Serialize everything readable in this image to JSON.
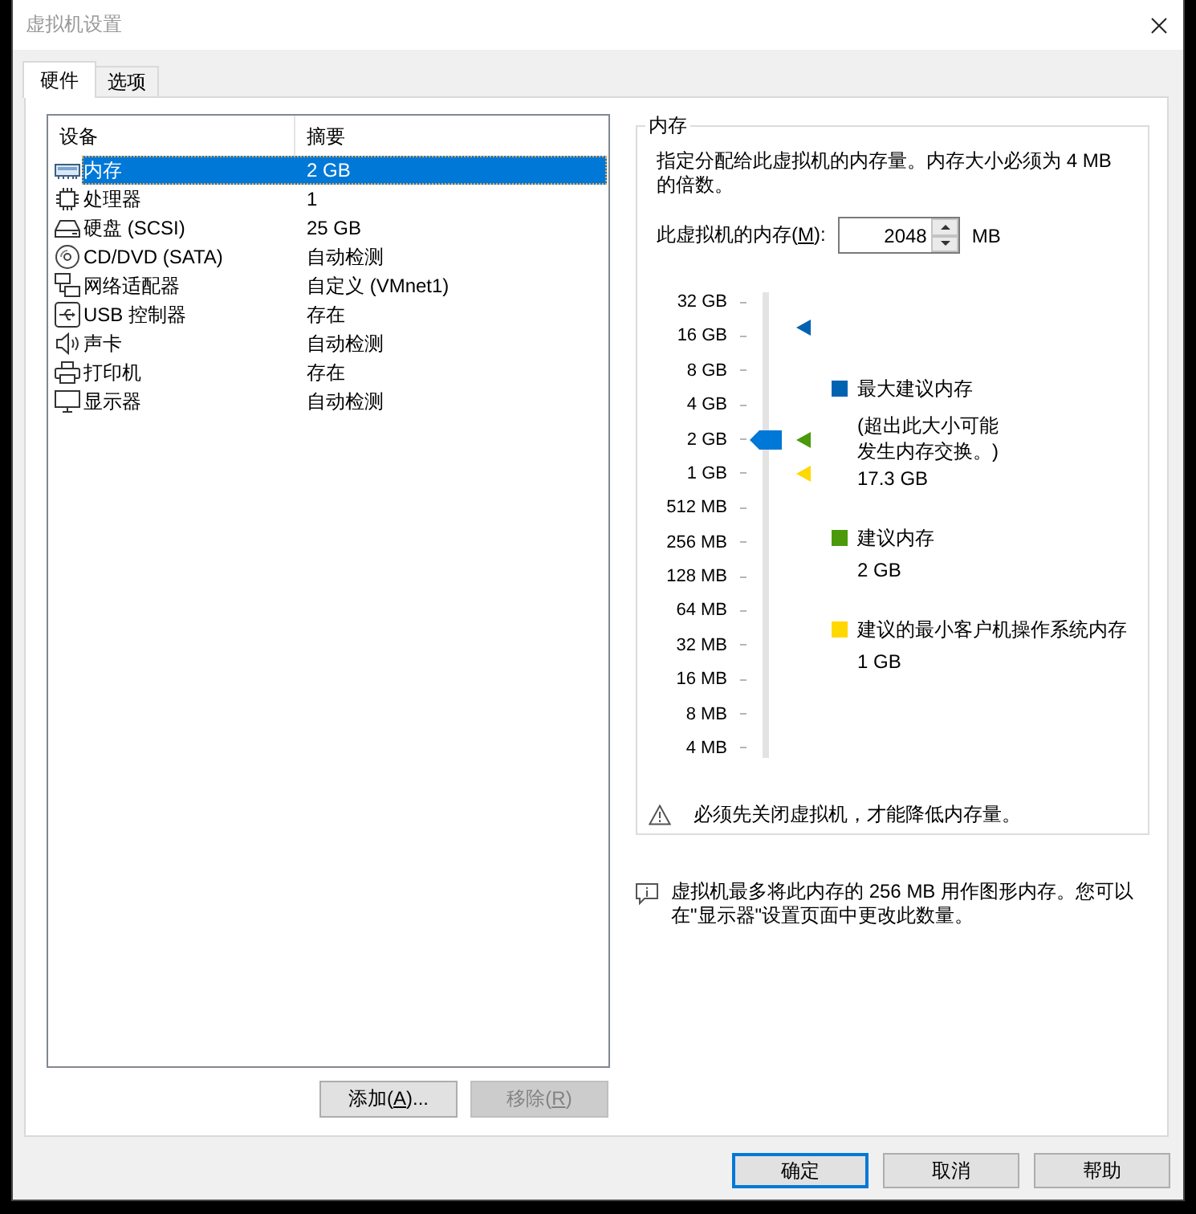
{
  "window": {
    "title": "虚拟机设置"
  },
  "tabs": [
    {
      "label": "硬件",
      "selected": true
    },
    {
      "label": "选项",
      "selected": false
    }
  ],
  "device_list": {
    "columns": [
      "设备",
      "摘要"
    ],
    "rows": [
      {
        "kind": "memory",
        "device": "内存",
        "summary": "2 GB",
        "selected": true
      },
      {
        "kind": "cpu",
        "device": "处理器",
        "summary": "1",
        "selected": false
      },
      {
        "kind": "disk",
        "device": "硬盘 (SCSI)",
        "summary": "25 GB",
        "selected": false
      },
      {
        "kind": "optical",
        "device": "CD/DVD (SATA)",
        "summary": "自动检测",
        "selected": false
      },
      {
        "kind": "network",
        "device": "网络适配器",
        "summary": "自定义 (VMnet1)",
        "selected": false
      },
      {
        "kind": "usb",
        "device": "USB 控制器",
        "summary": "存在",
        "selected": false
      },
      {
        "kind": "sound",
        "device": "声卡",
        "summary": "自动检测",
        "selected": false
      },
      {
        "kind": "printer",
        "device": "打印机",
        "summary": "存在",
        "selected": false
      },
      {
        "kind": "display",
        "device": "显示器",
        "summary": "自动检测",
        "selected": false
      }
    ]
  },
  "list_buttons": [
    {
      "label_before": "添加(",
      "mnemonic": "A",
      "label_after": ")...",
      "disabled": false
    },
    {
      "label_before": "移除(",
      "mnemonic": "R",
      "label_after": ")",
      "disabled": true
    }
  ],
  "memory": {
    "title": "内存",
    "description": "指定分配给此虚拟机的内存量。内存大小必须为 4 MB 的倍数。",
    "field": {
      "label_before": "此虚拟机的内存(",
      "mnemonic": "M",
      "label_after": "):",
      "value": "2048",
      "unit": "MB"
    },
    "slider": {
      "ticks": [
        "32 GB",
        "16 GB",
        "8 GB",
        "4 GB",
        "2 GB",
        "1 GB",
        "512 MB",
        "256 MB",
        "128 MB",
        "64 MB",
        "32 MB",
        "16 MB",
        "8 MB",
        "4 MB"
      ],
      "level": 0.6923,
      "markers": [
        {
          "color": "#0063b1",
          "level": 0.942
        },
        {
          "color": "#4a9a0c",
          "level": 0.6923
        },
        {
          "color": "#ffd800",
          "level": 0.6154
        }
      ]
    },
    "recommendations": [
      {
        "color": "#0063b1",
        "title": "最大建议内存",
        "note": "(超出此大小可能发生内存交换。)",
        "value": "17.3 GB"
      },
      {
        "color": "#4a9a0c",
        "title": "建议内存",
        "value": "2 GB"
      },
      {
        "color": "#ffd800",
        "title": "建议的最小客户机操作系统内存",
        "value": "1 GB"
      }
    ],
    "warning": "必须先关闭虚拟机，才能降低内存量。"
  },
  "info_note": "虚拟机最多将此内存的 256 MB 用作图形内存。您可以在\"显示器\"设置页面中更改此数量。",
  "dialog_buttons": [
    {
      "label": "确定",
      "default": true
    },
    {
      "label": "取消",
      "default": false
    },
    {
      "label": "帮助",
      "default": false
    }
  ]
}
